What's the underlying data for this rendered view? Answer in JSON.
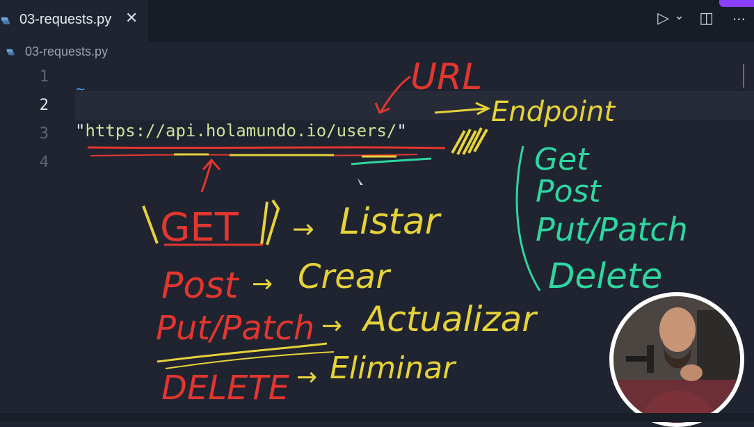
{
  "tab": {
    "filename": "03-requests.py",
    "close_glyph": "✕"
  },
  "breadcrumb": {
    "filename": "03-requests.py"
  },
  "toolbar": {
    "run_glyph": "▷",
    "run_menu_glyph": "⌄",
    "split_glyph": "◫",
    "more_glyph": "···"
  },
  "gutter": {
    "lines": [
      "1",
      "2",
      "3",
      "4"
    ]
  },
  "editor": {
    "url_string": "https://api.holamundo.io/users/",
    "quote": "\""
  },
  "annotations": {
    "url": "URL",
    "endpoint": "Endpoint",
    "methods_left": [
      {
        "method": "GET",
        "arrow": "→",
        "action": "Listar"
      },
      {
        "method": "Post",
        "arrow": "→",
        "action": "Crear"
      },
      {
        "method": "Put/Patch",
        "arrow": "→",
        "action": "Actualizar"
      },
      {
        "method": "DELETE",
        "arrow": "→",
        "action": "Eliminar"
      }
    ],
    "methods_right": [
      "Get",
      "Post",
      "Put/Patch",
      "Delete"
    ]
  },
  "colors": {
    "red": "#e2362f",
    "yellow": "#e6d23a",
    "green": "#2fd6a0",
    "string": "#cbe29a"
  }
}
